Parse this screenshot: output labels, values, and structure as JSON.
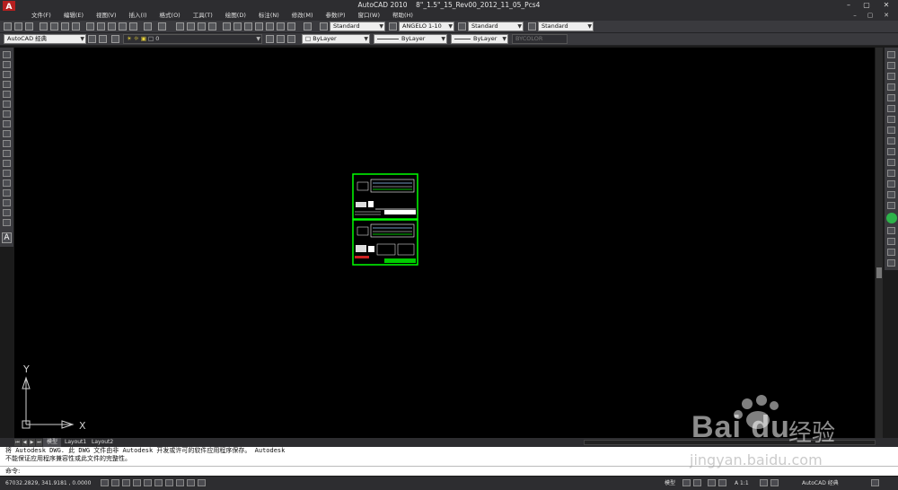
{
  "window": {
    "app_name": "AutoCAD 2010",
    "file_name": "8\"_1.5\"_15_Rev00_2012_11_05_Pcs4",
    "app_logo": "A",
    "minimize": "–",
    "maximize": "▢",
    "close": "✕"
  },
  "menu": [
    "文件(F)",
    "编辑(E)",
    "视图(V)",
    "插入(I)",
    "格式(O)",
    "工具(T)",
    "绘图(D)",
    "标注(N)",
    "修改(M)",
    "参数(P)",
    "窗口(W)",
    "帮助(H)"
  ],
  "toolbar": {
    "text_style": "Standard",
    "dim_style": "ANGELO 1-10",
    "table_style": "Standard",
    "mleader_style": "Standard",
    "workspace": "AutoCAD 经典",
    "layer": "0",
    "color": "ByLayer",
    "linetype": "ByLayer",
    "lineweight": "ByLayer",
    "plot_style": "BYCOLOR"
  },
  "ucs": {
    "x_label": "X",
    "y_label": "Y"
  },
  "tabs": [
    "模型",
    "Layout1",
    "Layout2"
  ],
  "command": {
    "history_line1": "将 Autodesk DWG.  此 DWG 文件由非 Autodesk 开发或许可的软件应用程序保存。  Autodesk",
    "history_line2": "不能保证应用程序兼容性或此文件的完整性。",
    "prompt": "命令:"
  },
  "status": {
    "coordinates": "67032.2829,  341.9181 , 0.0000",
    "model_label": "模型",
    "scale": "A 1:1",
    "workspace_label": "AutoCAD 经典"
  },
  "watermark": {
    "brand": "Bai du",
    "suffix": "经验",
    "url": "jingyan.baidu.com"
  },
  "colors": {
    "canvas": "#000000",
    "drawing_frame": "#00ff00",
    "chrome": "#2d2d30",
    "toolbar": "#3a3a3e"
  }
}
